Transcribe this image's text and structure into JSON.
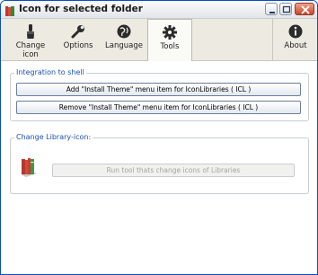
{
  "window": {
    "title": "Icon for selected folder"
  },
  "toolbar": {
    "tabs": [
      {
        "label": "Change\nicon",
        "icon": "brush-icon"
      },
      {
        "label": "Options",
        "icon": "wrench-icon"
      },
      {
        "label": "Language",
        "icon": "globe-icon"
      },
      {
        "label": "Tools",
        "icon": "gear-icon",
        "selected": true
      },
      {
        "label": "About",
        "icon": "info-icon"
      }
    ]
  },
  "integration": {
    "legend": "Integration to shell",
    "add_label": "Add \"Install Theme\" menu item for IconLibraries ( ICL )",
    "remove_label": "Remove \"Install Theme\" menu item for IconLibraries ( ICL )"
  },
  "library": {
    "legend": "Change Library-icon:",
    "run_label": "Run tool thats change icons of Libraries"
  },
  "colors": {
    "accent": "#1f4fb2",
    "toolbar_bg": "#eceae1",
    "selected_tab_bg": "#fafaf6"
  }
}
